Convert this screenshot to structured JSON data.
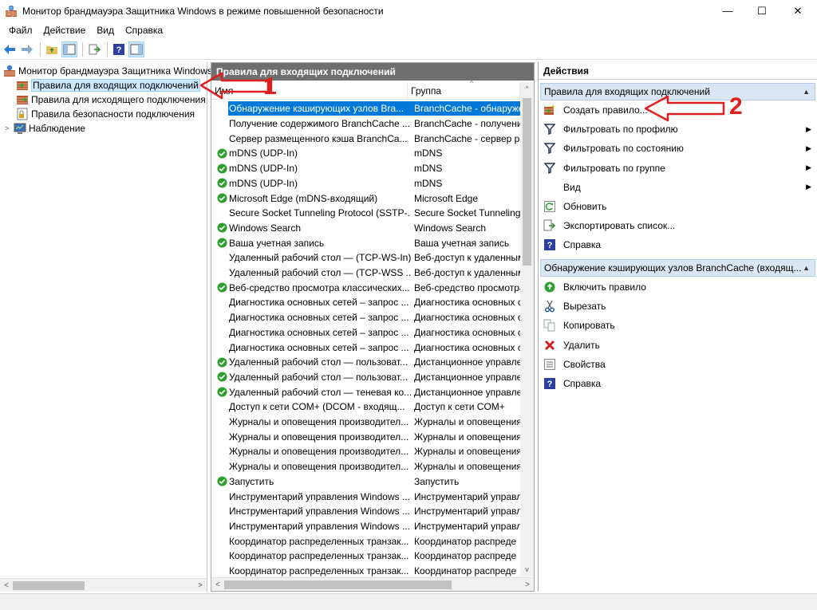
{
  "window": {
    "title": "Монитор брандмауэра Защитника Windows в режиме повышенной безопасности",
    "controls": [
      "—",
      "☐",
      "✕"
    ]
  },
  "menu": [
    "Файл",
    "Действие",
    "Вид",
    "Справка"
  ],
  "tree": {
    "root": "Монитор брандмауэра Защитника Windows",
    "items": [
      {
        "label": "Правила для входящих подключений",
        "selected": true
      },
      {
        "label": "Правила для исходящего подключения",
        "selected": false
      },
      {
        "label": "Правила безопасности подключения",
        "selected": false
      },
      {
        "label": "Наблюдение",
        "selected": false
      }
    ]
  },
  "center": {
    "title": "Правила для входящих подключений",
    "columns": [
      "Имя",
      "Группа"
    ],
    "rows": [
      {
        "name": "Обнаружение кэширующих узлов Bra...",
        "group": "BranchCache - обнаружен",
        "enabled": false,
        "selected": true
      },
      {
        "name": "Получение содержимого BranchCache ...",
        "group": "BranchCache - получение",
        "enabled": false
      },
      {
        "name": "Сервер размещенного кэша BranchCa...",
        "group": "BranchCache - сервер раз",
        "enabled": false
      },
      {
        "name": "mDNS (UDP-In)",
        "group": "mDNS",
        "enabled": true
      },
      {
        "name": "mDNS (UDP-In)",
        "group": "mDNS",
        "enabled": true
      },
      {
        "name": "mDNS (UDP-In)",
        "group": "mDNS",
        "enabled": true
      },
      {
        "name": "Microsoft Edge (mDNS-входящий)",
        "group": "Microsoft Edge",
        "enabled": true
      },
      {
        "name": "Secure Socket Tunneling Protocol (SSTP-...",
        "group": "Secure Socket Tunneling P",
        "enabled": false
      },
      {
        "name": "Windows Search",
        "group": "Windows Search",
        "enabled": true
      },
      {
        "name": "Ваша учетная запись",
        "group": "Ваша учетная запись",
        "enabled": true
      },
      {
        "name": "Удаленный рабочий стол — (TCP-WS-In)",
        "group": "Веб-доступ к удаленным",
        "enabled": false
      },
      {
        "name": "Удаленный рабочий стол — (TCP-WSS ...",
        "group": "Веб-доступ к удаленным",
        "enabled": false
      },
      {
        "name": "Веб-средство просмотра классических...",
        "group": "Веб-средство просмотра",
        "enabled": true
      },
      {
        "name": "Диагностика основных сетей – запрос ...",
        "group": "Диагностика основных с",
        "enabled": false
      },
      {
        "name": "Диагностика основных сетей – запрос ...",
        "group": "Диагностика основных с",
        "enabled": false
      },
      {
        "name": "Диагностика основных сетей – запрос ...",
        "group": "Диагностика основных с",
        "enabled": false
      },
      {
        "name": "Диагностика основных сетей – запрос ...",
        "group": "Диагностика основных с",
        "enabled": false
      },
      {
        "name": "Удаленный рабочий стол — пользоват...",
        "group": "Дистанционное управле",
        "enabled": true
      },
      {
        "name": "Удаленный рабочий стол — пользоват...",
        "group": "Дистанционное управле",
        "enabled": true
      },
      {
        "name": "Удаленный рабочий стол — теневая ко...",
        "group": "Дистанционное управле",
        "enabled": true
      },
      {
        "name": "Доступ к сети COM+ (DCOM - входящ...",
        "group": "Доступ к сети COM+",
        "enabled": false
      },
      {
        "name": "Журналы и оповещения производител...",
        "group": "Журналы и оповещения",
        "enabled": false
      },
      {
        "name": "Журналы и оповещения производител...",
        "group": "Журналы и оповещения",
        "enabled": false
      },
      {
        "name": "Журналы и оповещения производител...",
        "group": "Журналы и оповещения",
        "enabled": false
      },
      {
        "name": "Журналы и оповещения производител...",
        "group": "Журналы и оповещения",
        "enabled": false
      },
      {
        "name": "Запустить",
        "group": "Запустить",
        "enabled": true
      },
      {
        "name": "Инструментарий управления Windows ...",
        "group": "Инструментарий управл",
        "enabled": false
      },
      {
        "name": "Инструментарий управления Windows ...",
        "group": "Инструментарий управл",
        "enabled": false
      },
      {
        "name": "Инструментарий управления Windows ...",
        "group": "Инструментарий управл",
        "enabled": false
      },
      {
        "name": "Координатор распределенных транзак...",
        "group": "Координатор распреде",
        "enabled": false
      },
      {
        "name": "Координатор распределенных транзак...",
        "group": "Координатор распреде",
        "enabled": false
      },
      {
        "name": "Координатор распределенных транзак...",
        "group": "Координатор распреде",
        "enabled": false
      }
    ]
  },
  "actions": {
    "title": "Действия",
    "section1": {
      "label": "Правила для входящих подключений",
      "items": [
        {
          "label": "Создать правило...",
          "icon": "new-rule-icon",
          "submenu": false
        },
        {
          "label": "Фильтровать по профилю",
          "icon": "filter-icon",
          "submenu": true
        },
        {
          "label": "Фильтровать по состоянию",
          "icon": "filter-icon",
          "submenu": true
        },
        {
          "label": "Фильтровать по группе",
          "icon": "filter-icon",
          "submenu": true
        },
        {
          "label": "Вид",
          "icon": "",
          "submenu": true
        },
        {
          "label": "Обновить",
          "icon": "refresh-icon",
          "submenu": false
        },
        {
          "label": "Экспортировать список...",
          "icon": "export-icon",
          "submenu": false
        },
        {
          "label": "Справка",
          "icon": "help-icon",
          "submenu": false
        }
      ]
    },
    "section2": {
      "label": "Обнаружение кэширующих узлов BranchCache (входящ...",
      "items": [
        {
          "label": "Включить правило",
          "icon": "enable-icon"
        },
        {
          "label": "Вырезать",
          "icon": "cut-icon"
        },
        {
          "label": "Копировать",
          "icon": "copy-icon"
        },
        {
          "label": "Удалить",
          "icon": "delete-icon"
        },
        {
          "label": "Свойства",
          "icon": "properties-icon"
        },
        {
          "label": "Справка",
          "icon": "help-icon"
        }
      ]
    }
  },
  "annotations": [
    "1",
    "2"
  ],
  "colors": {
    "selection": "#0078d7",
    "panel_header": "#6f6f6f",
    "section": "#d9e7f5",
    "annotation": "#e02020",
    "check": "#2e9e2e"
  }
}
